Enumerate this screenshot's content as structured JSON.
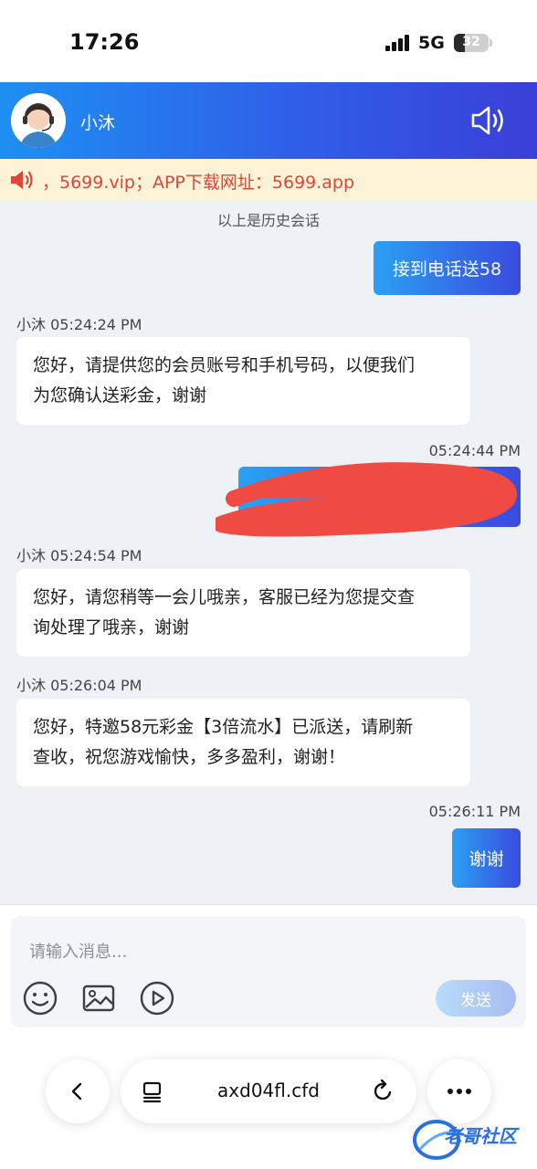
{
  "status_bar": {
    "time": "17:26",
    "network": "5G",
    "battery": "32",
    "battery_level": 0.32
  },
  "header": {
    "agent_name": "小沐"
  },
  "notice": {
    "text": "，5699.vip；APP下载网址：5699.app"
  },
  "history_label": "以上是历史会话",
  "messages": [
    {
      "from": "user",
      "text": "接到电话送58"
    },
    {
      "from": "agent",
      "meta": "小沐 05:24:24 PM",
      "lines": [
        "您好，请提供您的会员账号和手机号码，以便我们",
        "为您确认送彩金，谢谢"
      ]
    },
    {
      "from": "user",
      "meta": "05:24:44 PM",
      "redacted": true
    },
    {
      "from": "agent",
      "meta": "小沐 05:24:54 PM",
      "lines": [
        "您好，请您稍等一会儿哦亲，客服已经为您提交查",
        "询处理了哦亲，谢谢"
      ]
    },
    {
      "from": "agent",
      "meta": "小沐 05:26:04 PM",
      "lines": [
        "您好，特邀58元彩金【3倍流水】已派送，请刷新",
        "查收，祝您游戏愉快，多多盈利，谢谢！"
      ]
    },
    {
      "from": "user",
      "meta": "05:26:11 PM",
      "text": "谢谢"
    }
  ],
  "composer": {
    "placeholder": "请输入消息...",
    "send_label": "发送"
  },
  "browser": {
    "url": "axd04fl.cfd"
  },
  "watermark": {
    "text": "老哥社区"
  },
  "icons": {
    "speaker": "speaker-icon",
    "notice": "megaphone-icon",
    "emoji": "emoji-icon",
    "image": "image-icon",
    "video": "play-icon",
    "back": "chevron-left-icon",
    "tabs": "tabs-icon",
    "reload": "reload-icon",
    "more": "more-icon"
  },
  "colors": {
    "accent": "#2f5fe8",
    "notice_text": "#e0453a",
    "notice_bg": "#fdf3d6"
  }
}
